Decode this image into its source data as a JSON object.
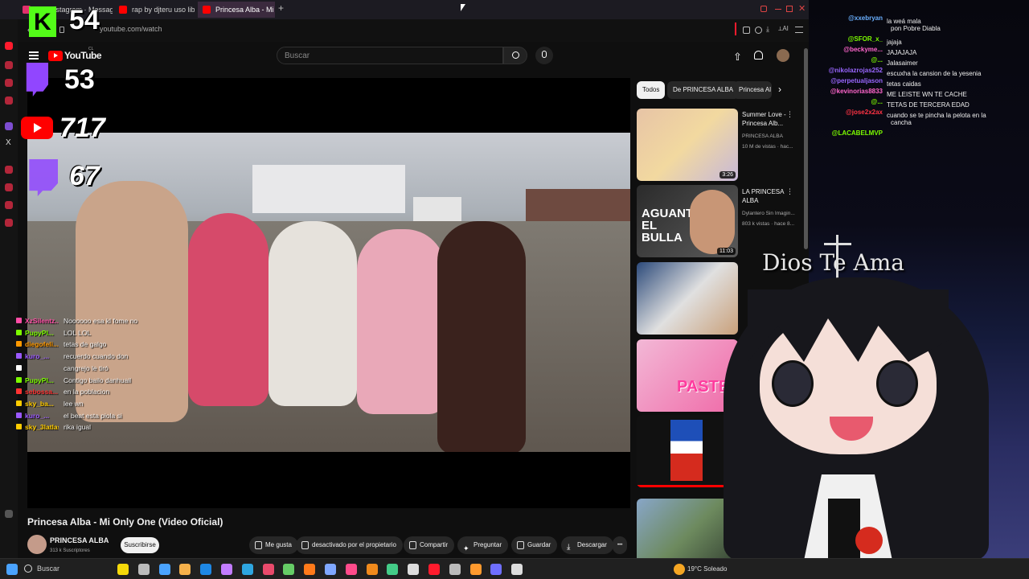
{
  "browser": {
    "tabs": [
      {
        "label": "63 · Instagram · Messages",
        "color": "#e1306c"
      },
      {
        "label": "rap by djteru uso libre - Yo",
        "color": "#ff0000"
      },
      {
        "label": "Princesa Alba - Mi On",
        "color": "#ff0000"
      }
    ],
    "new_tab": "+",
    "url": "youtube.com/watch",
    "accent": "#ff1b2d"
  },
  "youtube": {
    "logo_text": "YouTube",
    "country": "CL",
    "search_placeholder": "Buscar",
    "video_title": "Princesa Alba - Mi Only One (Video Oficial)",
    "channel_name": "PRINCESA ALBA",
    "subscribers": "313 k Suscriptores",
    "subscribe_label": "Suscribirse",
    "actions": {
      "like": "Me gusta",
      "dislike": "desactivado por el propietario",
      "share": "Compartir",
      "ask": "Preguntar",
      "save": "Guardar",
      "download": "Descargar",
      "more": "•••"
    },
    "chips": [
      "Todos",
      "De PRINCESA ALBA",
      "Princesa Al"
    ],
    "related": [
      {
        "title": "Summer Love - Princesa Alb...",
        "channel": "PRINCESA ALBA",
        "meta": "10 M de vistas · hac...",
        "duration": "3:26"
      },
      {
        "title": "LA PRINCESA ALBA",
        "channel": "Dylantero Sin Imagin...",
        "meta": "803 k vistas · hace 8...",
        "duration": "11:03",
        "thumb_text": "AGUANTE EL BULLA"
      },
      {
        "title": "",
        "channel": "",
        "meta": "",
        "duration": ""
      },
      {
        "title": "",
        "channel": "",
        "meta": "",
        "duration": "",
        "thumb_text": "PASTE"
      },
      {
        "title": "",
        "channel": "",
        "meta": "",
        "duration": ""
      },
      {
        "title": "",
        "channel": "",
        "meta": "",
        "duration": ""
      }
    ]
  },
  "overlay": {
    "stats": [
      {
        "platform": "kick",
        "value": "54",
        "color": "#53fc18"
      },
      {
        "platform": "twitch",
        "value": "53",
        "color": "#9146ff"
      },
      {
        "platform": "youtube",
        "value": "717",
        "color": "#ff0000"
      },
      {
        "platform": "twitch",
        "value": "67",
        "color": "#9146ff"
      }
    ],
    "left_chat": [
      {
        "user": "XzSilentz...",
        "msg": "Noooooo esa kl fome no",
        "color": "#ff4da6"
      },
      {
        "user": "PupyPl...",
        "msg": "LOL LOL",
        "color": "#7cfc00"
      },
      {
        "user": "diegofeli...",
        "msg": "tetas de galgo",
        "color": "#ff9900"
      },
      {
        "user": "kuro_...",
        "msg": "recuerdo cuando don",
        "color": "#9b59ff"
      },
      {
        "user": "",
        "msg": "cangrejo le tiró",
        "color": "#ffffff"
      },
      {
        "user": "PupyPl...",
        "msg": "Contigo bailo danhuail",
        "color": "#7cfc00"
      },
      {
        "user": "sebossa...",
        "msg": "en la poblacion",
        "color": "#ff3333"
      },
      {
        "user": "sky_ba...",
        "msg": "lee wn",
        "color": "#ffcc00"
      },
      {
        "user": "kuro_...",
        "msg": "el beat esta piola si",
        "color": "#9b59ff"
      },
      {
        "user": "sky_3latlas",
        "msg": "rika igual",
        "color": "#ffcc00"
      }
    ],
    "right_chat": [
      {
        "user": "@xxebryan",
        "msg": "la weá mala",
        "color": "#6ab0ff"
      },
      {
        "user": "",
        "msg": "pon Pobre Diabla",
        "color": "#ffffff"
      },
      {
        "user": "@SFOR_x_",
        "msg": "jajaja",
        "color": "#7cfc00"
      },
      {
        "user": "@beckyme...",
        "msg": "JAJAJAJA",
        "color": "#ff66cc"
      },
      {
        "user": "@...",
        "msg": "Jalasaimer",
        "color": "#7cfc00"
      },
      {
        "user": "@nikolazrojas252",
        "msg": "escuxha la cansion de la yesenia",
        "color": "#9966ff"
      },
      {
        "user": "@perpetualjason",
        "msg": "tetas caidas",
        "color": "#9966ff"
      },
      {
        "user": "@kevinorias8833",
        "msg": "ME LEISTE WN TE CACHE",
        "color": "#ff66cc"
      },
      {
        "user": "@...",
        "msg": "TETAS DE TERCERA EDAD",
        "color": "#7cfc00"
      },
      {
        "user": "@jose2x2ax",
        "msg": "cuando se te pincha la pelota en la",
        "color": "#ff3344"
      },
      {
        "user": "",
        "msg": "cancha",
        "color": "#ffffff"
      },
      {
        "user": "@LACABELMVP",
        "msg": "",
        "color": "#7cfc00"
      }
    ],
    "banner_text": "Dios Te Ama"
  },
  "taskbar": {
    "search_placeholder": "Buscar",
    "weather": "19°C  Soleado"
  }
}
